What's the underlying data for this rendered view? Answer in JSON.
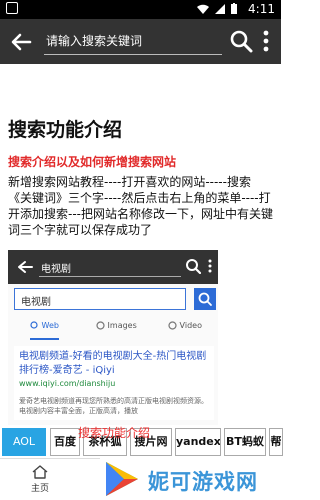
{
  "status_bar": {
    "time": "4:11",
    "icons": [
      "notification-icon",
      "wifi-icon",
      "signal-icon",
      "battery-icon"
    ]
  },
  "app_bar": {
    "search_placeholder": "请输入搜索关键词"
  },
  "content": {
    "title": "搜索功能介绍",
    "subtitle": "搜索介绍以及如何新增搜索网站",
    "paragraph": "新增搜索网站教程----打开喜欢的网站-----搜索《关键词》三个字----然后点击右上角的菜单----打开添加搜索---把网站名称修改一下，网址中有关键词三个字就可以保存成功了"
  },
  "example_screenshot": {
    "toolbar_text": "电视剧",
    "search_value": "电视剧",
    "tabs": [
      "Web",
      "Images",
      "Video"
    ],
    "result": {
      "title": "电视剧频道-好看的电视剧大全-热门电视剧排行榜-爱奇艺 - iQiyi",
      "url": "www.iqiyi.com/dianshiju",
      "desc": "爱奇艺电视剧频道再现您所熟悉的高清正版电视剧视频资源。电视剧内容丰富全面，正版高清，播放"
    }
  },
  "engines": {
    "items": [
      "AOL",
      "百度",
      "茶杯狐",
      "搜片网",
      "yandex",
      "BT蚂蚁",
      "帮"
    ],
    "active_index": 0,
    "overlay_text": "搜索功能介绍"
  },
  "bottom_nav": {
    "home_label": "主页"
  },
  "watermark": {
    "text": "妮可游戏网"
  },
  "colors": {
    "app_bar": "#333333",
    "accent": "#29a4e3",
    "subtitle_red": "#e12a2a",
    "link_blue": "#2c57c6"
  }
}
